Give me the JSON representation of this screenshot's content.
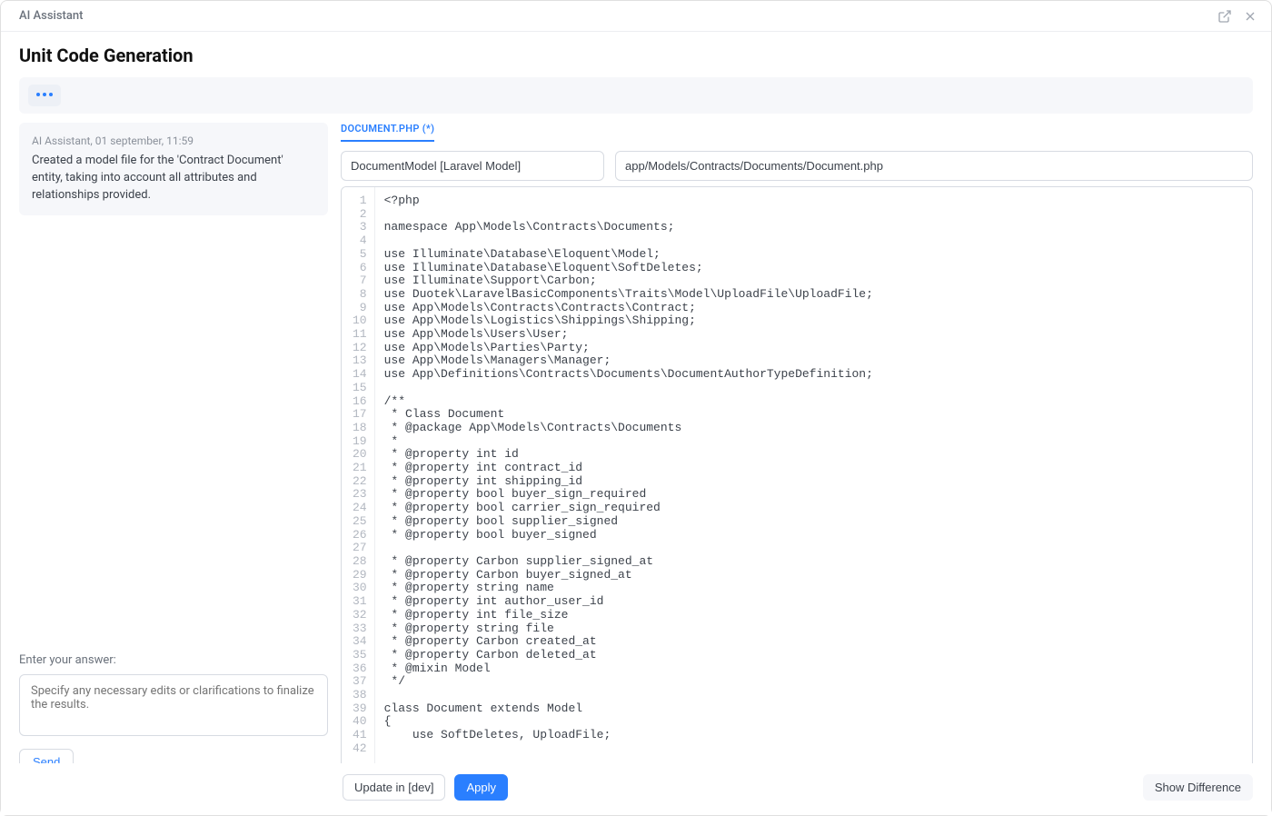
{
  "app": {
    "title": "AI Assistant"
  },
  "page": {
    "title": "Unit Code Generation"
  },
  "message": {
    "meta": "AI Assistant, 01 september, 11:59",
    "body": "Created a model file for the 'Contract Document' entity, taking into account all attributes and relationships provided."
  },
  "answer": {
    "label": "Enter your answer:",
    "placeholder": "Specify any necessary edits or clarifications to finalize the results.",
    "send": "Send"
  },
  "file": {
    "tab": "DOCUMENT.PHP (*)",
    "descriptor": "DocumentModel [Laravel Model]",
    "path": "app/Models/Contracts/Documents/Document.php"
  },
  "code_lines": [
    "<?php",
    "",
    "namespace App\\Models\\Contracts\\Documents;",
    "",
    "use Illuminate\\Database\\Eloquent\\Model;",
    "use Illuminate\\Database\\Eloquent\\SoftDeletes;",
    "use Illuminate\\Support\\Carbon;",
    "use Duotek\\LaravelBasicComponents\\Traits\\Model\\UploadFile\\UploadFile;",
    "use App\\Models\\Contracts\\Contracts\\Contract;",
    "use App\\Models\\Logistics\\Shippings\\Shipping;",
    "use App\\Models\\Users\\User;",
    "use App\\Models\\Parties\\Party;",
    "use App\\Models\\Managers\\Manager;",
    "use App\\Definitions\\Contracts\\Documents\\DocumentAuthorTypeDefinition;",
    "",
    "/**",
    " * Class Document",
    " * @package App\\Models\\Contracts\\Documents",
    " *",
    " * @property int id",
    " * @property int contract_id",
    " * @property int shipping_id",
    " * @property bool buyer_sign_required",
    " * @property bool carrier_sign_required",
    " * @property bool supplier_signed",
    " * @property bool buyer_signed",
    "",
    " * @property Carbon supplier_signed_at",
    " * @property Carbon buyer_signed_at",
    " * @property string name",
    " * @property int author_user_id",
    " * @property int file_size",
    " * @property string file",
    " * @property Carbon created_at",
    " * @property Carbon deleted_at",
    " * @mixin Model",
    " */",
    "",
    "class Document extends Model",
    "{",
    "    use SoftDeletes, UploadFile;",
    ""
  ],
  "footer": {
    "update_in": "Update in [dev]",
    "apply": "Apply",
    "show_diff": "Show Difference"
  }
}
